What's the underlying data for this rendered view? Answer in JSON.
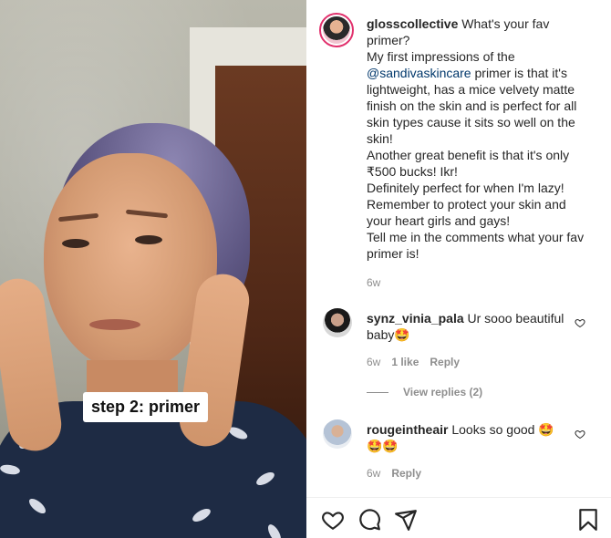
{
  "media": {
    "caption_sticker": "step 2: primer"
  },
  "post": {
    "username": "glosscollective",
    "caption": {
      "line1_after_user": " What's your fav",
      "line2": "primer?",
      "line3": "My first impressions of the",
      "mention": "@sandivaskincare",
      "line4_after_mention": " primer is that it's",
      "line5": "lightweight, has a mice velvety matte",
      "line6": "finish on the skin and is perfect for all",
      "line7": "skin types cause it sits so well on the",
      "line8": "skin!",
      "line9": "Another great benefit is that it's only",
      "line10": "₹500 bucks! Ikr!",
      "line11": "Definitely perfect for when I'm lazy!",
      "line12": "Remember to protect your skin and",
      "line13": "your heart girls and gays!",
      "line14": "Tell me in the comments what your fav",
      "line15": "primer is!"
    },
    "time": "6w"
  },
  "comments": [
    {
      "username": "synz_vinia_pala",
      "text_line1": " Ur sooo beautiful",
      "text_line2": "baby",
      "emoji": "🤩",
      "time": "6w",
      "likes": "1 like",
      "reply_label": "Reply",
      "view_replies": "View replies (2)"
    },
    {
      "username": "rougeintheair",
      "text_line1": " Looks so good ",
      "emoji1": "🤩",
      "emoji_line2": "🤩🤩",
      "time": "6w",
      "reply_label": "Reply"
    }
  ],
  "icons": {
    "like": "heart-icon",
    "comment": "comment-icon",
    "share": "share-icon",
    "save": "bookmark-icon"
  }
}
